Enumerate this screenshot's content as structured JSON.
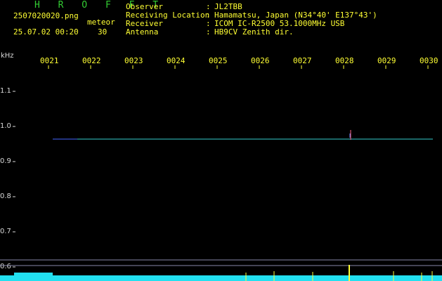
{
  "header": {
    "app_title": "H R O F F T",
    "file_name": "2507020020.png",
    "timestamp": "25.07.02 00:20",
    "meteor_label": "meteor",
    "meteor_count": "30",
    "fields": [
      {
        "label": "Observer",
        "value": "JL2TBB"
      },
      {
        "label": "Receiving Location",
        "value": "Hamamatsu, Japan (N34°40' E137°43')"
      },
      {
        "label": "Receiver",
        "value": "ICOM IC-R2500 53.1000MHz USB"
      },
      {
        "label": "Antenna",
        "value": "HB9CV Zenith dir."
      }
    ]
  },
  "axis": {
    "y_unit": "kHz",
    "y_labels": [
      "1.1",
      "1.0",
      "0.9",
      "0.8",
      "0.7",
      "0.6"
    ],
    "x_labels": [
      "0021",
      "0022",
      "0023",
      "0024",
      "0025",
      "0026",
      "0027",
      "0028",
      "0029",
      "0030"
    ]
  },
  "colors": {
    "yellow": "#ffff33",
    "green": "#33cc33",
    "beacon": "#33cccc",
    "noise": "#22e0f0"
  }
}
